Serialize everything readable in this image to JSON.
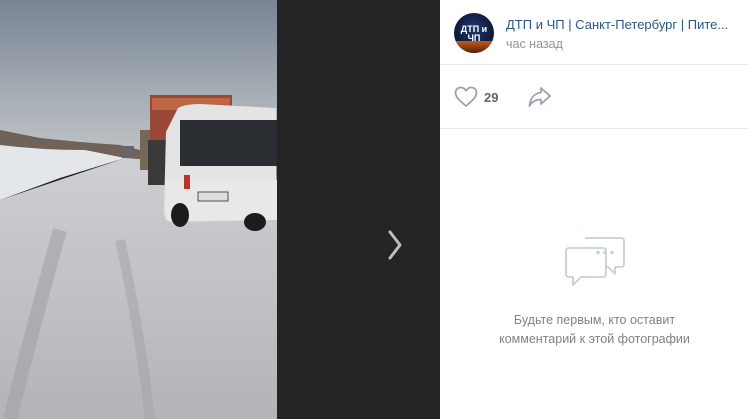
{
  "group": {
    "name": "ДТП и ЧП | Санкт-Петербург | Пите...",
    "avatar_text": "ДТП и ЧП"
  },
  "post": {
    "time": "час назад"
  },
  "likes": {
    "count": "29"
  },
  "comments": {
    "empty_text": "Будьте первым, кто оставит\nкомментарий к этой фотографии"
  },
  "icons": {
    "like": "heart-icon",
    "share": "share-arrow-icon",
    "next": "chevron-right-icon",
    "comments": "comment-bubbles-icon"
  },
  "colors": {
    "link": "#2a5885",
    "muted": "#939393",
    "icon": "#99a2ad"
  }
}
